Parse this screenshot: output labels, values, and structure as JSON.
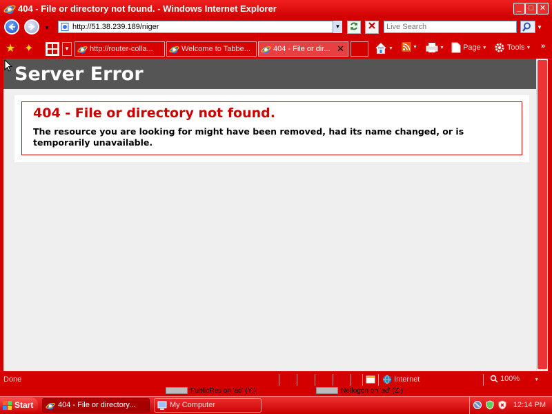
{
  "window": {
    "title": "404 - File or directory not found. - Windows Internet Explorer",
    "minimize": "_",
    "maximize": "□",
    "close": "✕"
  },
  "address_bar": {
    "url": "http://51.38.239.189/niger",
    "search_placeholder": "Live Search"
  },
  "tabs": [
    {
      "label": "http://router-colla...",
      "active": false
    },
    {
      "label": "Welcome to Tabbe...",
      "active": false
    },
    {
      "label": "404 - File or dir...",
      "active": true,
      "close": "✕"
    }
  ],
  "commands": {
    "page": "Page",
    "tools": "Tools"
  },
  "page": {
    "header": "Server Error",
    "error_title": "404 - File or directory not found.",
    "error_message": "The resource you are looking for might have been removed, had its name changed, or is temporarily unavailable."
  },
  "status_bar": {
    "status": "Done",
    "zone": "Internet",
    "zoom": "100%"
  },
  "drives": [
    {
      "label": "PublicRes on 'ad' (Y:)"
    },
    {
      "label": "Netlogon on 'ad' (Z:)"
    }
  ],
  "taskbar": {
    "start": "Start",
    "tasks": [
      {
        "label": "404 - File or directory...",
        "active": true
      },
      {
        "label": "My Computer",
        "active": false
      }
    ],
    "clock": "12:14 PM"
  },
  "colors": {
    "chrome": "#d40000",
    "page_header": "#555555",
    "error_red": "#cc0000"
  }
}
